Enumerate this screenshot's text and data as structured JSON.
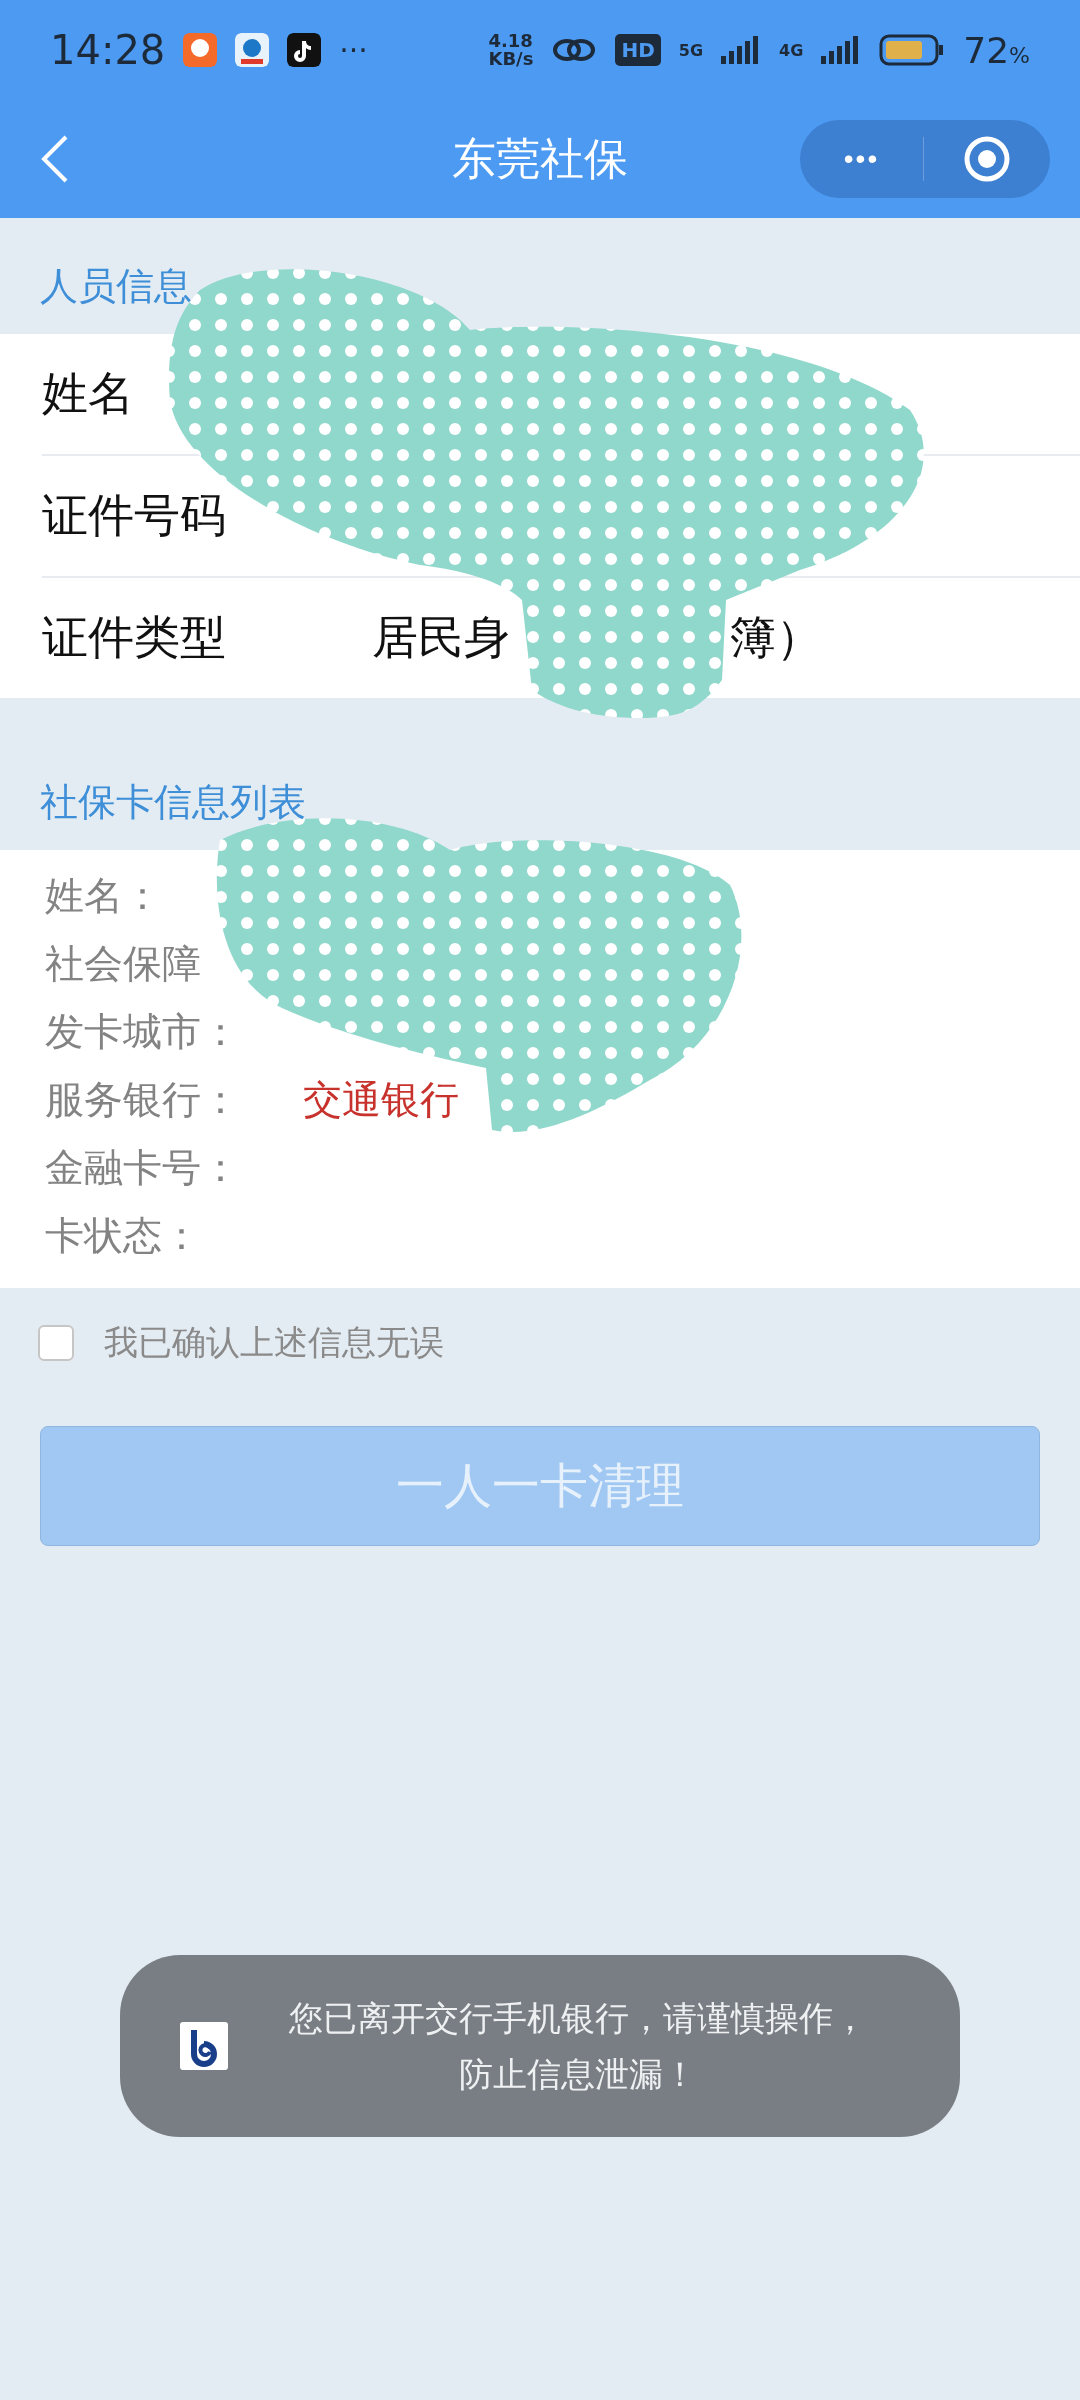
{
  "status_bar": {
    "time": "14:28",
    "more": "···",
    "speed_value": "4.18",
    "speed_unit": "KB/s",
    "hd_label": "HD",
    "network_a": "5G",
    "network_b": "4G",
    "battery_level_text": "72",
    "battery_unit": "%"
  },
  "nav": {
    "title": "东莞社保",
    "menu": "•••"
  },
  "person_section": {
    "header": "人员信息",
    "rows": [
      {
        "label": "姓名"
      },
      {
        "label": "证件号码"
      },
      {
        "label": "证件类型",
        "value": "居民身",
        "value_tail": "簿）"
      }
    ]
  },
  "card_section": {
    "header": "社保卡信息列表",
    "rows": [
      {
        "label": "姓名："
      },
      {
        "label": "社会保障"
      },
      {
        "label": "发卡城市："
      },
      {
        "label": "服务银行：",
        "value": "交通银行"
      },
      {
        "label": "金融卡号："
      },
      {
        "label": "卡状态："
      }
    ]
  },
  "confirm": {
    "label": "我已确认上述信息无误",
    "checked": false
  },
  "submit": {
    "label": "一人一卡清理",
    "disabled": true
  },
  "toast": {
    "text": "您已离开交行手机银行，请谨慎操作，防止信息泄漏！"
  }
}
